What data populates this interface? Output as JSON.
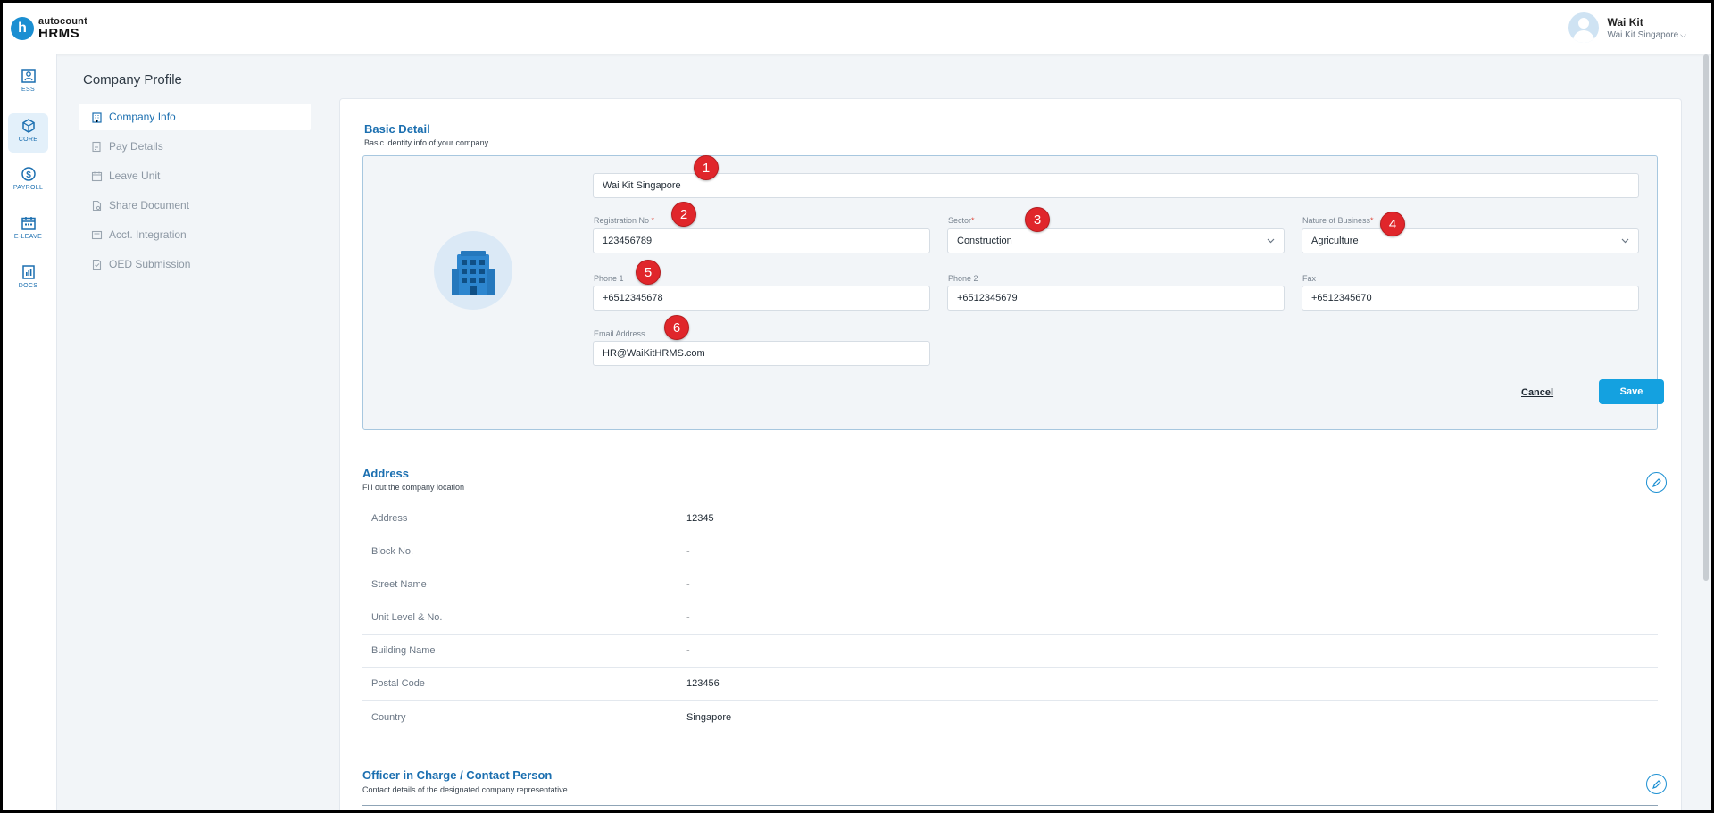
{
  "header": {
    "logo_small": "autocount",
    "logo_big": "HRMS",
    "user_name": "Wai Kit",
    "user_company": "Wai Kit Singapore"
  },
  "rail": [
    {
      "label": "ESS",
      "icon": "ess-icon"
    },
    {
      "label": "CORE",
      "icon": "core-icon"
    },
    {
      "label": "PAYROLL",
      "icon": "payroll-icon"
    },
    {
      "label": "E-LEAVE",
      "icon": "calendar-icon"
    },
    {
      "label": "DOCS",
      "icon": "docs-icon"
    }
  ],
  "page_title": "Company Profile",
  "subnav": [
    {
      "label": "Company Info"
    },
    {
      "label": "Pay Details"
    },
    {
      "label": "Leave Unit"
    },
    {
      "label": "Share Document"
    },
    {
      "label": "Acct. Integration"
    },
    {
      "label": "OED Submission"
    }
  ],
  "basic": {
    "title": "Basic Detail",
    "subtitle": "Basic identity info of your company",
    "company_name": "Wai Kit Singapore",
    "registration_label": "Registration No",
    "registration_value": "123456789",
    "sector_label": "Sector",
    "sector_value": "Construction",
    "nature_label": "Nature of Business",
    "nature_value": "Agriculture",
    "phone1_label": "Phone 1",
    "phone1_value": "+6512345678",
    "phone2_label": "Phone 2",
    "phone2_value": "+6512345679",
    "fax_label": "Fax",
    "fax_value": "+6512345670",
    "email_label": "Email Address",
    "email_value": "HR@WaiKitHRMS.com",
    "cancel_label": "Cancel",
    "save_label": "Save",
    "required_mark": "*"
  },
  "badges": [
    "1",
    "2",
    "3",
    "4",
    "5",
    "6"
  ],
  "address": {
    "title": "Address",
    "subtitle": "Fill out the company location",
    "rows": [
      {
        "key": "Address",
        "value": "12345"
      },
      {
        "key": "Block No.",
        "value": "-"
      },
      {
        "key": "Street Name",
        "value": "-"
      },
      {
        "key": "Unit Level & No.",
        "value": "-"
      },
      {
        "key": "Building Name",
        "value": "-"
      },
      {
        "key": "Postal Code",
        "value": "123456"
      },
      {
        "key": "Country",
        "value": "Singapore"
      }
    ]
  },
  "officer": {
    "title": "Officer in Charge / Contact Person",
    "subtitle": "Contact details of the designated company representative"
  },
  "colors": {
    "accent": "#1b6fb0",
    "save_button": "#14a1e0",
    "badge": "#e0262b"
  }
}
